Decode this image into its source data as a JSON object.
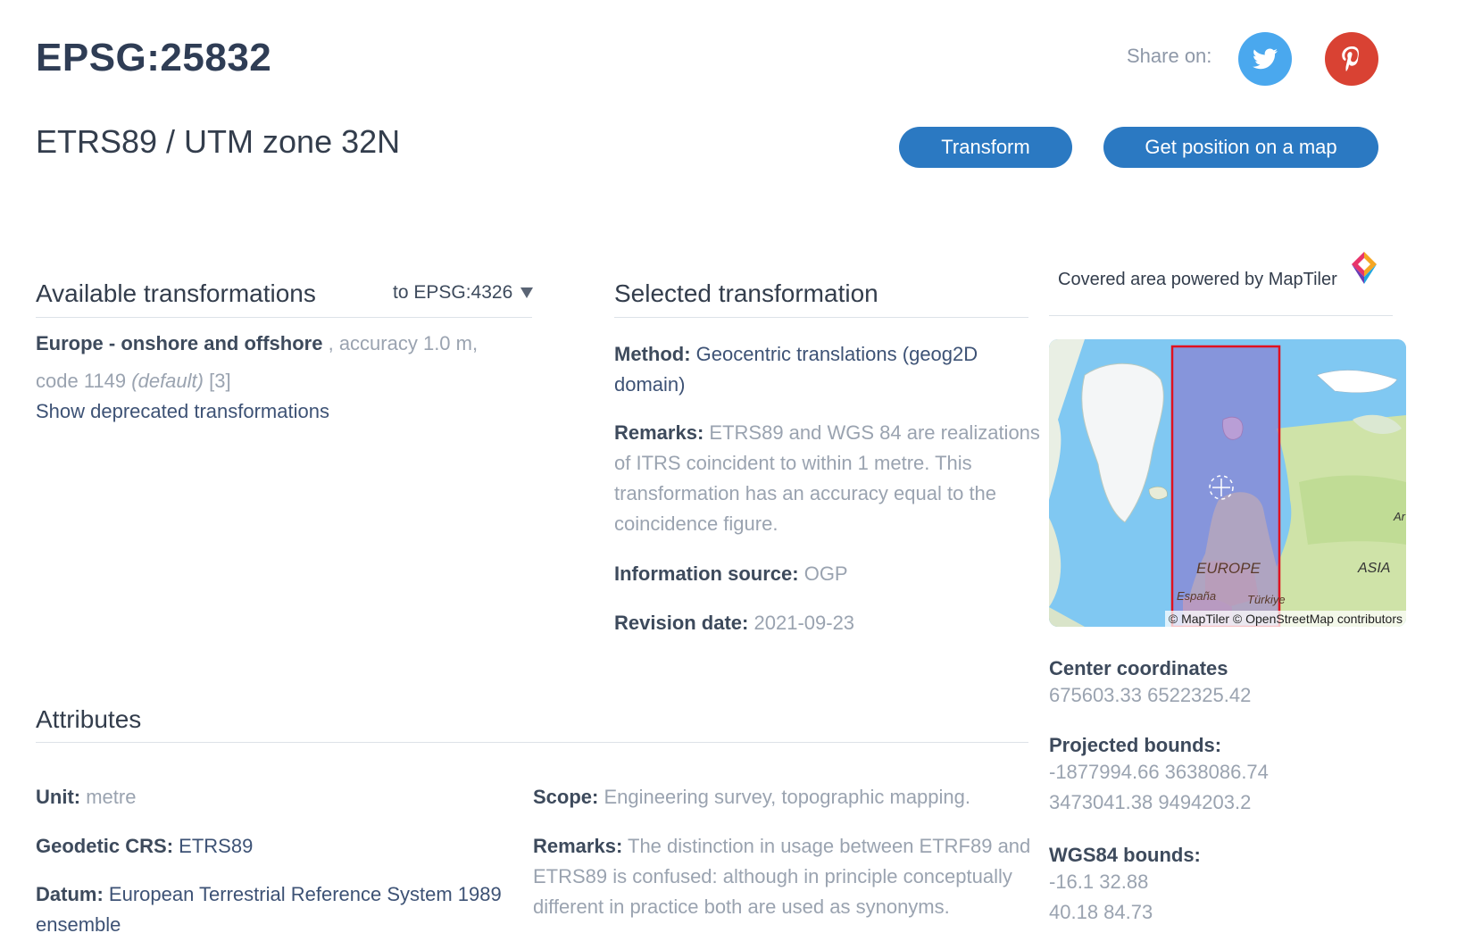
{
  "header": {
    "code": "EPSG:25832",
    "name": "ETRS89 / UTM zone 32N",
    "share_label": "Share on:",
    "transform_button": "Transform",
    "get_position_button": "Get position on a map"
  },
  "available_transformations": {
    "heading": "Available transformations",
    "target_select": "to EPSG:4326",
    "item": {
      "area": "Europe - onshore and offshore",
      "accuracy": ", accuracy 1.0 m,",
      "code": "code 1149",
      "default": "(default)",
      "count": "[3]"
    },
    "show_deprecated": "Show deprecated transformations"
  },
  "selected_transformation": {
    "heading": "Selected transformation",
    "method_label": "Method:",
    "method_value_1": "Geocentric translations (geog2D",
    "method_value_2": "domain)",
    "remarks_label": "Remarks:",
    "remarks_1": "ETRS89 and WGS 84 are realizations",
    "remarks_2": "of ITRS coincident to within 1 metre. This",
    "remarks_3": "transformation has an accuracy equal to the",
    "remarks_4": "coincidence figure.",
    "source_label": "Information source:",
    "source_value": "OGP",
    "revision_label": "Revision date:",
    "revision_value": "2021-09-23"
  },
  "coverage": {
    "label": "Covered area powered by MapTiler",
    "attribution": "© MapTiler © OpenStreetMap contributors",
    "map_labels": {
      "europe": "EUROPE",
      "asia": "ASIA",
      "espana": "España",
      "turkiye": "Türkiye",
      "ar": "Ar"
    },
    "center_label": "Center coordinates",
    "center_value": "675603.33 6522325.42",
    "projected_label": "Projected bounds:",
    "projected_1": "-1877994.66 3638086.74",
    "projected_2": "3473041.38 9494203.2",
    "wgs84_label": "WGS84 bounds:",
    "wgs84_1": "-16.1 32.88",
    "wgs84_2": "40.18 84.73"
  },
  "attributes": {
    "heading": "Attributes",
    "unit_label": "Unit:",
    "unit_value": "metre",
    "geodetic_label": "Geodetic CRS:",
    "geodetic_value": "ETRS89",
    "datum_label": "Datum:",
    "datum_value_1": "European Terrestrial Reference System 1989",
    "datum_value_2": "ensemble",
    "scope_label": "Scope:",
    "scope_value": "Engineering survey, topographic mapping.",
    "remarks_label": "Remarks:",
    "remarks_1": "The distinction in usage between ETRF89 and",
    "remarks_2": "ETRS89 is confused: although in principle conceptually",
    "remarks_3": "different in practice both are used as synonyms."
  },
  "colors": {
    "accent": "#2b79c2",
    "twitter": "#4aa8ee",
    "pinterest": "#d94233",
    "coverage_outline": "#e0111f"
  },
  "icons": [
    "twitter-icon",
    "pinterest-icon",
    "caret-down-icon",
    "maptiler-logo",
    "crosshair-icon"
  ]
}
